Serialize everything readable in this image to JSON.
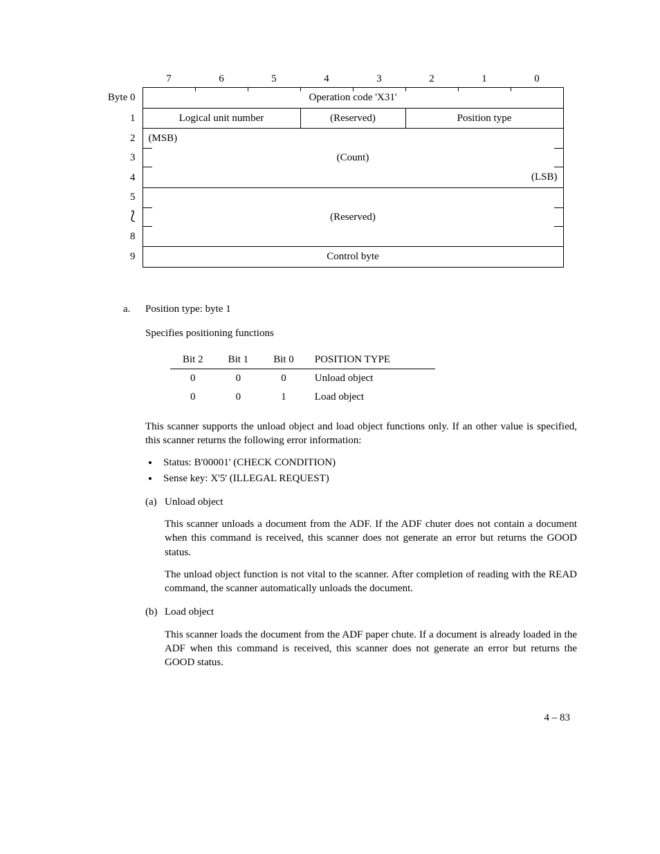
{
  "byteTable": {
    "bits": [
      "7",
      "6",
      "5",
      "4",
      "3",
      "2",
      "1",
      "0"
    ],
    "rows": {
      "byte0_label": "Byte 0",
      "r1_label": "1",
      "r2_label": "2",
      "r3_label": "3",
      "r4_label": "4",
      "r5_label": "5",
      "r8_label": "8",
      "r9_label": "9"
    },
    "opcode": "Operation code 'X31'",
    "lun": "Logical unit number",
    "reserved1": "(Reserved)",
    "postype": "Position type",
    "msb": "(MSB)",
    "count": "(Count)",
    "lsb": "(LSB)",
    "reserved2": "(Reserved)",
    "ctrl": "Control byte"
  },
  "sectionA": {
    "marker": "a.",
    "title": "Position type:  byte 1",
    "intro": "Specifies positioning functions",
    "posTable": {
      "h_bit2": "Bit 2",
      "h_bit1": "Bit 1",
      "h_bit0": "Bit 0",
      "h_pt": "POSITION TYPE",
      "rows": [
        {
          "b2": "0",
          "b1": "0",
          "b0": "0",
          "pt": "Unload object"
        },
        {
          "b2": "0",
          "b1": "0",
          "b0": "1",
          "pt": "Load object"
        }
      ]
    },
    "para1": "This scanner supports the unload object and load object functions only.  If an other value is specified, this scanner returns the following error information:",
    "bullets": [
      "Status:  B'00001'  (CHECK CONDITION)",
      "Sense key:   X'5'  (ILLEGAL REQUEST)"
    ],
    "subA": {
      "marker": "(a)",
      "title": "Unload object",
      "p1": "This scanner unloads a document from the ADF.  If the ADF chuter does not contain a document when this command is received, this scanner does not generate an error  but returns the GOOD status.",
      "p2": "The unload object function is not vital to the scanner.  After completion of reading with the READ command, the scanner automatically unloads the document."
    },
    "subB": {
      "marker": "(b)",
      "title": "Load object",
      "p1": "This scanner loads the document from the ADF paper chute.  If a document is already loaded in the ADF when this command is received, this scanner does not generate an error  but returns the GOOD status."
    }
  },
  "pageNumber": "4 – 83"
}
